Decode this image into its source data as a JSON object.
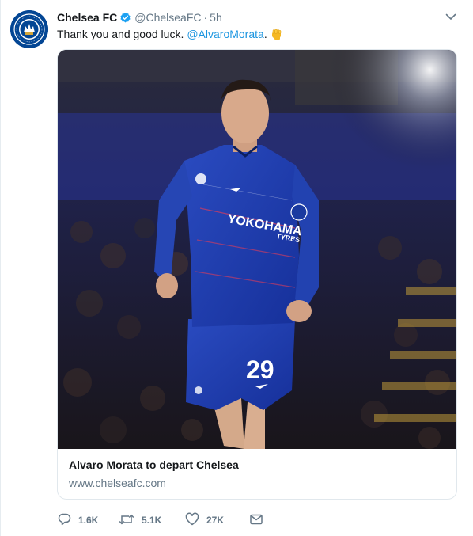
{
  "tweet": {
    "account_name": "Chelsea FC",
    "handle": "@ChelseaFC",
    "separator": "·",
    "time": "5h",
    "text": "Thank you and good luck.",
    "mention": "@AlvaroMorata",
    "text_end": ".",
    "verified": true
  },
  "card": {
    "title": "Alvaro Morata to depart Chelsea",
    "domain": "www.chelseafc.com",
    "shirt_sponsor": "YOKOHAMA",
    "shirt_sponsor_sub": "TYRES",
    "shirt_number": "29"
  },
  "actions": {
    "replies": "1.6K",
    "retweets": "5.1K",
    "likes": "27K"
  },
  "colors": {
    "link": "#1b95e0",
    "muted": "#657786",
    "text": "#14171a",
    "chelsea_blue": "#034694",
    "kit_blue": "#1e3fa8"
  },
  "icons": {
    "verified": "verified-badge-icon",
    "caret": "chevron-down-icon",
    "emoji": "raised-fist-emoji",
    "reply": "reply-icon",
    "retweet": "retweet-icon",
    "like": "heart-icon",
    "dm": "envelope-icon"
  }
}
